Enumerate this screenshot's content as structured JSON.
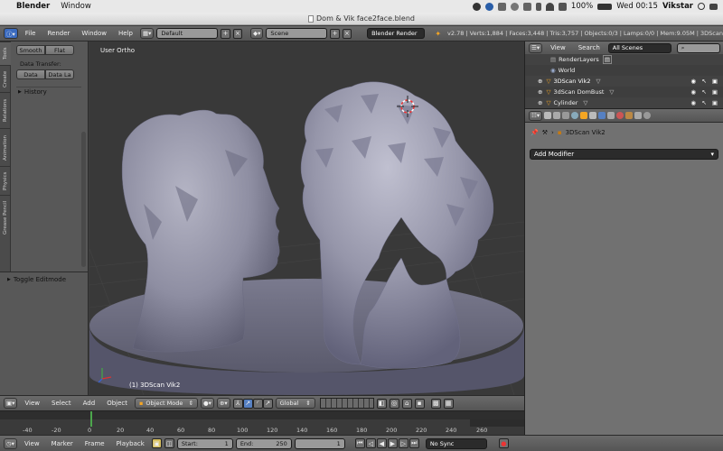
{
  "mac_menubar": {
    "apple": "",
    "app_name": "Blender",
    "window_menu": "Window",
    "battery": "100%",
    "clock": "Wed 00:15",
    "user": "Vikstar"
  },
  "window": {
    "title": "Dom & Vik face2face.blend"
  },
  "info_header": {
    "menus": [
      "File",
      "Render",
      "Window",
      "Help"
    ],
    "layout": "Default",
    "scene": "Scene",
    "engine": "Blender Render",
    "stats": "v2.78 | Verts:1,884 | Faces:3,448 | Tris:3,757 | Objects:0/3 | Lamps:0/0 | Mem:9.05M | 3DScan"
  },
  "tool_shelf": {
    "tabs": [
      "Tools",
      "Create",
      "Relations",
      "Animation",
      "Physics",
      "Grease Pencil"
    ],
    "smooth": "Smooth",
    "flat": "Flat",
    "data_transfer_label": "Data Transfer:",
    "data": "Data",
    "data_layers": "Data La",
    "history": "History",
    "toggle_editmode": "Toggle Editmode"
  },
  "viewport": {
    "view_name": "User Ortho",
    "object_label": "(1) 3DScan Vik2"
  },
  "view3d_header": {
    "menus": [
      "View",
      "Select",
      "Add",
      "Object"
    ],
    "mode": "Object Mode",
    "orientation": "Global"
  },
  "timeline": {
    "ticks": [
      "-40",
      "-20",
      "0",
      "20",
      "40",
      "60",
      "80",
      "100",
      "120",
      "140",
      "160",
      "180",
      "200",
      "220",
      "240",
      "260"
    ],
    "current_frame_value": 0,
    "menus": [
      "View",
      "Marker",
      "Frame",
      "Playback"
    ],
    "start_label": "Start:",
    "start_value": "1",
    "end_label": "End:",
    "end_value": "250",
    "current_frame": "1",
    "sync": "No Sync"
  },
  "outliner": {
    "menus": [
      "View",
      "Search"
    ],
    "filter": "All Scenes",
    "items": [
      {
        "label": "RenderLayers"
      },
      {
        "label": "World"
      },
      {
        "label": "3DScan Vik2"
      },
      {
        "label": "3dScan DomBust"
      },
      {
        "label": "Cylinder"
      }
    ]
  },
  "properties": {
    "breadcrumb": "3DScan Vik2",
    "add_modifier": "Add Modifier"
  },
  "colors": {
    "mesh": "#8a8a9c",
    "platform": "#6c6c80",
    "grid": "#454545"
  }
}
